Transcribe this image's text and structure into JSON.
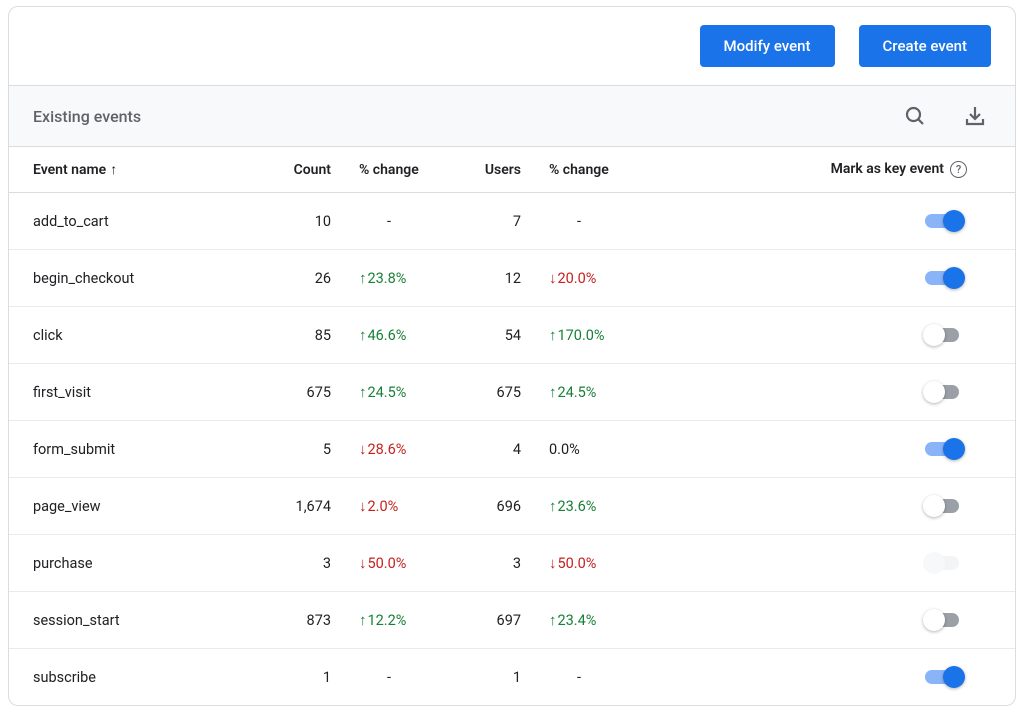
{
  "actions": {
    "modify_label": "Modify event",
    "create_label": "Create event"
  },
  "section": {
    "title": "Existing events"
  },
  "columns": {
    "event_name": "Event name",
    "count": "Count",
    "pct_change": "% change",
    "users": "Users",
    "pct_change_users": "% change",
    "mark_key": "Mark as key event"
  },
  "sort": {
    "column": "event_name",
    "direction_label": "↑"
  },
  "events": [
    {
      "name": "add_to_cart",
      "count": "10",
      "count_change": {
        "text": "-",
        "dir": "none"
      },
      "users": "7",
      "users_change": {
        "text": "-",
        "dir": "none"
      },
      "key": "on"
    },
    {
      "name": "begin_checkout",
      "count": "26",
      "count_change": {
        "text": "23.8%",
        "dir": "up"
      },
      "users": "12",
      "users_change": {
        "text": "20.0%",
        "dir": "down"
      },
      "key": "on"
    },
    {
      "name": "click",
      "count": "85",
      "count_change": {
        "text": "46.6%",
        "dir": "up"
      },
      "users": "54",
      "users_change": {
        "text": "170.0%",
        "dir": "up"
      },
      "key": "off"
    },
    {
      "name": "first_visit",
      "count": "675",
      "count_change": {
        "text": "24.5%",
        "dir": "up"
      },
      "users": "675",
      "users_change": {
        "text": "24.5%",
        "dir": "up"
      },
      "key": "off"
    },
    {
      "name": "form_submit",
      "count": "5",
      "count_change": {
        "text": "28.6%",
        "dir": "down"
      },
      "users": "4",
      "users_change": {
        "text": "0.0%",
        "dir": "neutral"
      },
      "key": "on"
    },
    {
      "name": "page_view",
      "count": "1,674",
      "count_change": {
        "text": "2.0%",
        "dir": "down"
      },
      "users": "696",
      "users_change": {
        "text": "23.6%",
        "dir": "up"
      },
      "key": "off"
    },
    {
      "name": "purchase",
      "count": "3",
      "count_change": {
        "text": "50.0%",
        "dir": "down"
      },
      "users": "3",
      "users_change": {
        "text": "50.0%",
        "dir": "down"
      },
      "key": "disabled"
    },
    {
      "name": "session_start",
      "count": "873",
      "count_change": {
        "text": "12.2%",
        "dir": "up"
      },
      "users": "697",
      "users_change": {
        "text": "23.4%",
        "dir": "up"
      },
      "key": "off"
    },
    {
      "name": "subscribe",
      "count": "1",
      "count_change": {
        "text": "-",
        "dir": "none"
      },
      "users": "1",
      "users_change": {
        "text": "-",
        "dir": "none"
      },
      "key": "on"
    }
  ]
}
